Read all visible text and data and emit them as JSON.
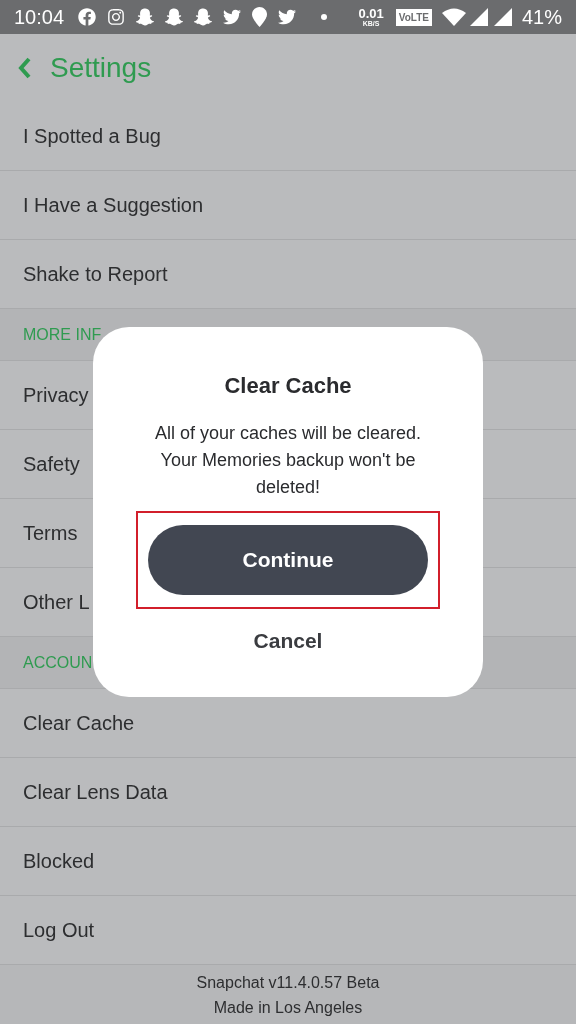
{
  "status_bar": {
    "time": "10:04",
    "speed": "0.01",
    "speed_unit": "KB/S",
    "network_badge": "VoLTE",
    "battery": "41%"
  },
  "header": {
    "title": "Settings"
  },
  "rows": [
    {
      "kind": "item",
      "label": "I Spotted a Bug"
    },
    {
      "kind": "item",
      "label": "I Have a Suggestion"
    },
    {
      "kind": "item",
      "label": "Shake to Report"
    },
    {
      "kind": "section",
      "label": "MORE INF"
    },
    {
      "kind": "item",
      "label": "Privacy"
    },
    {
      "kind": "item",
      "label": "Safety"
    },
    {
      "kind": "item",
      "label": "Terms"
    },
    {
      "kind": "item",
      "label": "Other L"
    },
    {
      "kind": "section",
      "label": "ACCOUN"
    },
    {
      "kind": "item",
      "label": "Clear Cache"
    },
    {
      "kind": "item",
      "label": "Clear Lens Data"
    },
    {
      "kind": "item",
      "label": "Blocked"
    },
    {
      "kind": "item",
      "label": "Log Out"
    }
  ],
  "footer": [
    "Snapchat v11.4.0.57 Beta",
    "Made in Los Angeles"
  ],
  "dialog": {
    "title": "Clear Cache",
    "message": "All of your caches will be cleared. Your Memories backup won't be deleted!",
    "primary_button": "Continue",
    "primary_highlighted": true,
    "secondary_button": "Cancel"
  }
}
